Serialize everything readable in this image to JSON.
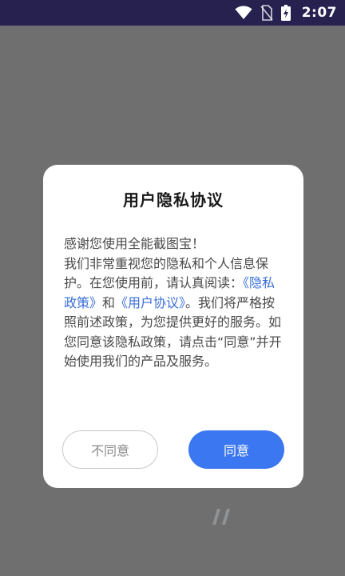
{
  "status_bar": {
    "time": "2:07",
    "icons": [
      "wifi-icon",
      "no-sim-icon",
      "battery-charging-icon"
    ]
  },
  "dialog": {
    "title": "用户隐私协议",
    "body": {
      "intro": "感谢您使用全能截图宝！",
      "text_before_links": "我们非常重视您的隐私和个人信息保护。在您使用前，请认真阅读：",
      "privacy_link": "《隐私政策》",
      "connector": "和",
      "user_agreement_link": "《用户协议》",
      "text_after_links": "。我们将严格按照前述政策，为您提供更好的服务。如您同意该隐私政策，请点击“同意”并开始使用我们的产品及服务。"
    },
    "buttons": {
      "disagree": "不同意",
      "agree": "同意"
    }
  },
  "colors": {
    "status_bar_bg": "#27214f",
    "overlay_bg": "#6f6f6f",
    "link": "#3a6fd8",
    "primary_button": "#3a77f0"
  }
}
